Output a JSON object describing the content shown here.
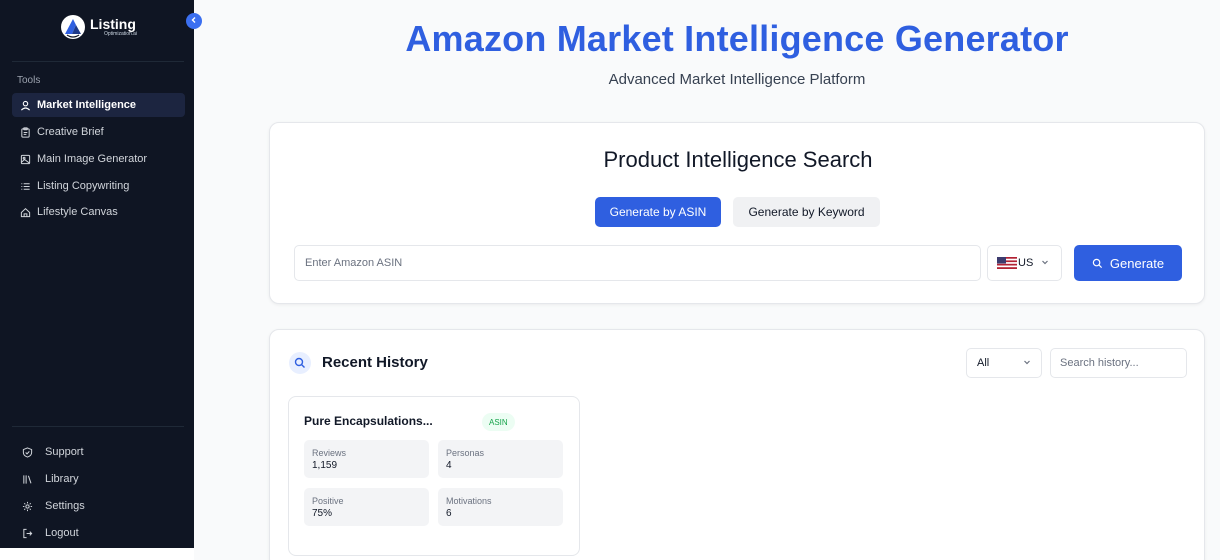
{
  "brand": {
    "name": "Listing",
    "sub": "Optimization.ai",
    "accent": "#2f5fe0"
  },
  "sidebar": {
    "section_label": "Tools",
    "items": [
      {
        "label": "Market Intelligence",
        "icon": "user-icon",
        "active": true
      },
      {
        "label": "Creative Brief",
        "icon": "clipboard-icon",
        "active": false
      },
      {
        "label": "Main Image Generator",
        "icon": "image-icon",
        "active": false
      },
      {
        "label": "Listing Copywriting",
        "icon": "list-icon",
        "active": false
      },
      {
        "label": "Lifestyle Canvas",
        "icon": "home-icon",
        "active": false
      }
    ],
    "bottom_items": [
      {
        "label": "Support",
        "icon": "shield-icon"
      },
      {
        "label": "Library",
        "icon": "library-icon"
      },
      {
        "label": "Settings",
        "icon": "gear-icon"
      },
      {
        "label": "Logout",
        "icon": "logout-icon"
      }
    ]
  },
  "header": {
    "title": "Amazon Market Intelligence Generator",
    "subtitle": "Advanced Market Intelligence Platform"
  },
  "search": {
    "title": "Product Intelligence Search",
    "mode_asin": "Generate by ASIN",
    "mode_keyword": "Generate by Keyword",
    "active_mode": "asin",
    "input_placeholder": "Enter Amazon ASIN",
    "country": "US",
    "generate_label": "Generate"
  },
  "history": {
    "title": "Recent History",
    "filter_value": "All",
    "search_placeholder": "Search history...",
    "cards": [
      {
        "name": "Pure Encapsulations...",
        "badge": "ASIN",
        "stats": [
          {
            "label": "Reviews",
            "value": "1,159"
          },
          {
            "label": "Personas",
            "value": "4"
          },
          {
            "label": "Positive",
            "value": "75%"
          },
          {
            "label": "Motivations",
            "value": "6"
          }
        ]
      }
    ]
  }
}
